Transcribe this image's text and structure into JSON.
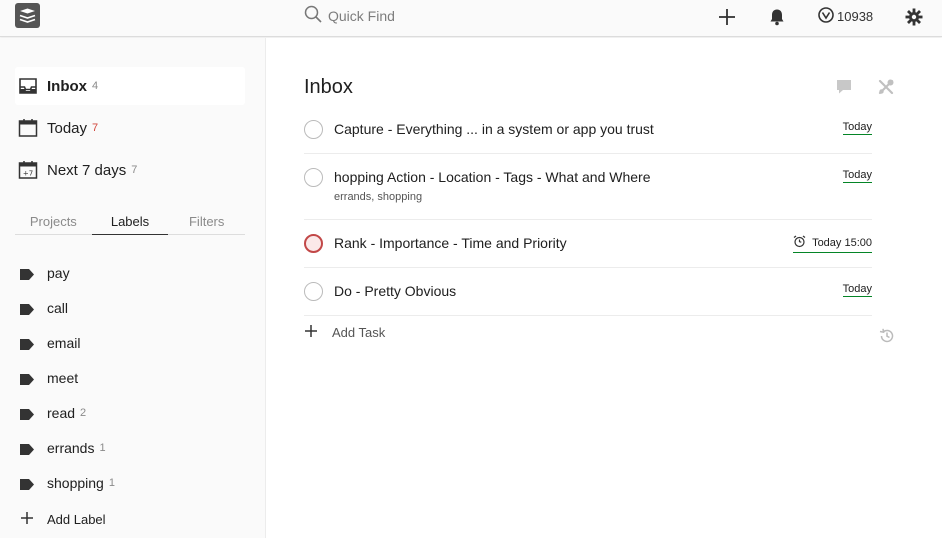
{
  "search": {
    "placeholder": "Quick Find"
  },
  "header": {
    "karma": "10938"
  },
  "sidebar": {
    "nav": [
      {
        "label": "Inbox",
        "count": "4"
      },
      {
        "label": "Today",
        "count": "7"
      },
      {
        "label": "Next 7 days",
        "count": "7"
      }
    ],
    "tabs": [
      "Projects",
      "Labels",
      "Filters"
    ],
    "labels": [
      {
        "name": "pay",
        "count": ""
      },
      {
        "name": "call",
        "count": ""
      },
      {
        "name": "email",
        "count": ""
      },
      {
        "name": "meet",
        "count": ""
      },
      {
        "name": "read",
        "count": "2"
      },
      {
        "name": "errands",
        "count": "1"
      },
      {
        "name": "shopping",
        "count": "1"
      }
    ],
    "add_label": "Add Label"
  },
  "main": {
    "title": "Inbox",
    "tasks": [
      {
        "text": "Capture - Everything ... in a system or app you trust",
        "labels": "",
        "due": "Today"
      },
      {
        "text": "hopping Action - Location - Tags - What and Where",
        "labels": "errands, shopping",
        "due": "Today"
      },
      {
        "text": "Rank - Importance - Time and Priority",
        "labels": "",
        "due": "Today 15:00"
      },
      {
        "text": "Do - Pretty Obvious",
        "labels": "",
        "due": "Today"
      }
    ],
    "add_task": "Add Task"
  },
  "colors": {
    "priority1": "#c24848",
    "due_underline": "#058527",
    "today_count": "#d1453b"
  }
}
